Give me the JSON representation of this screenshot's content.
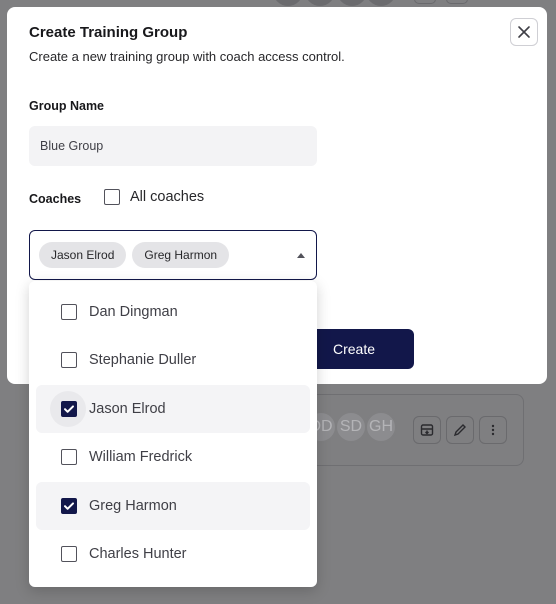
{
  "dialog": {
    "title": "Create Training Group",
    "subtitle": "Create a new training group with coach access control.",
    "close_icon": "close-icon"
  },
  "form": {
    "group_name_label": "Group Name",
    "group_name_value": "Blue Group",
    "coaches_label": "Coaches",
    "all_coaches_label": "All coaches",
    "all_coaches_checked": false,
    "selected_chips": [
      "Jason Elrod",
      "Greg Harmon"
    ],
    "create_label": "Create"
  },
  "dropdown": {
    "options": [
      {
        "label": "Dan Dingman",
        "checked": false
      },
      {
        "label": "Stephanie Duller",
        "checked": false
      },
      {
        "label": "Jason Elrod",
        "checked": true
      },
      {
        "label": "William Fredrick",
        "checked": false
      },
      {
        "label": "Greg Harmon",
        "checked": true
      },
      {
        "label": "Charles Hunter",
        "checked": false
      }
    ]
  },
  "background": {
    "avatars": [
      "DD",
      "SD",
      "GH"
    ],
    "icons": [
      "archive-icon",
      "edit-icon",
      "more-vertical-icon"
    ]
  },
  "colors": {
    "primary": "#12174a",
    "overlay": "#7f7f81"
  }
}
